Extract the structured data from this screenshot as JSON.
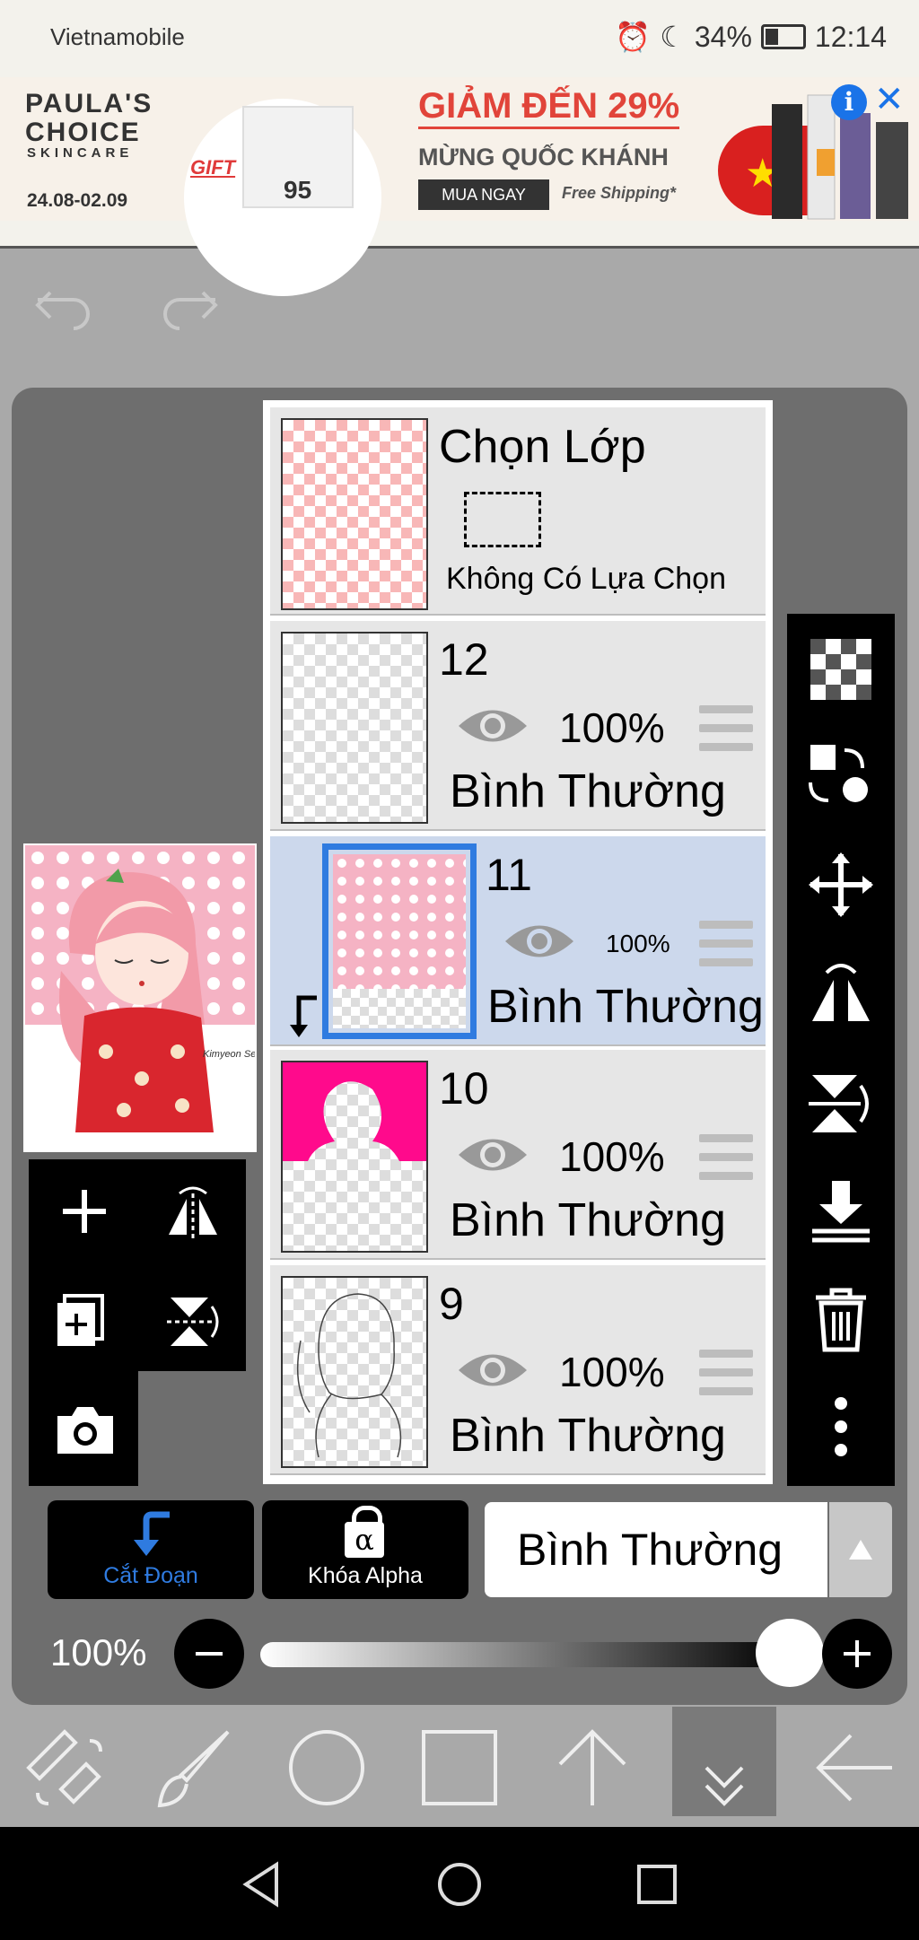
{
  "status_bar": {
    "carrier": "Vietnamobile",
    "battery": "34%",
    "time": "12:14"
  },
  "ad": {
    "brand_line1": "PAULA'S",
    "brand_line2": "CHOICE",
    "brand_sub": "SKINCARE",
    "dates": "24.08-02.09",
    "gift": "GIFT",
    "badge": "95",
    "headline": "GIẢM ĐẾN 29%",
    "subheadline": "MỪNG QUỐC KHÁNH",
    "cta": "MUA NGAY",
    "shipping": "Free Shipping*",
    "info": "i",
    "close": "✕"
  },
  "layers": [
    {
      "name": "Chọn Lớp",
      "subtitle": "Không Có Lựa Chọn"
    },
    {
      "name": "12",
      "opacity": "100%",
      "blend": "Bình Thường"
    },
    {
      "name": "11",
      "opacity": "100%",
      "blend": "Bình Thường"
    },
    {
      "name": "10",
      "opacity": "100%",
      "blend": "Bình Thường"
    },
    {
      "name": "9",
      "opacity": "100%",
      "blend": "Bình Thường"
    }
  ],
  "controls": {
    "clip_label": "Cắt Đoạn",
    "alpha_label": "Khóa Alpha",
    "alpha_symbol": "α",
    "blend_mode": "Bình Thường",
    "opacity": "100%",
    "opacity_level": 1.0
  },
  "preview": {
    "signature": "Kimyeon Seulgi"
  },
  "colors": {
    "accent_blue": "#2f7be0",
    "selected_layer_bg": "#ccd8ec",
    "pink": "#f8b7b7",
    "magenta": "#ff0a8c"
  }
}
